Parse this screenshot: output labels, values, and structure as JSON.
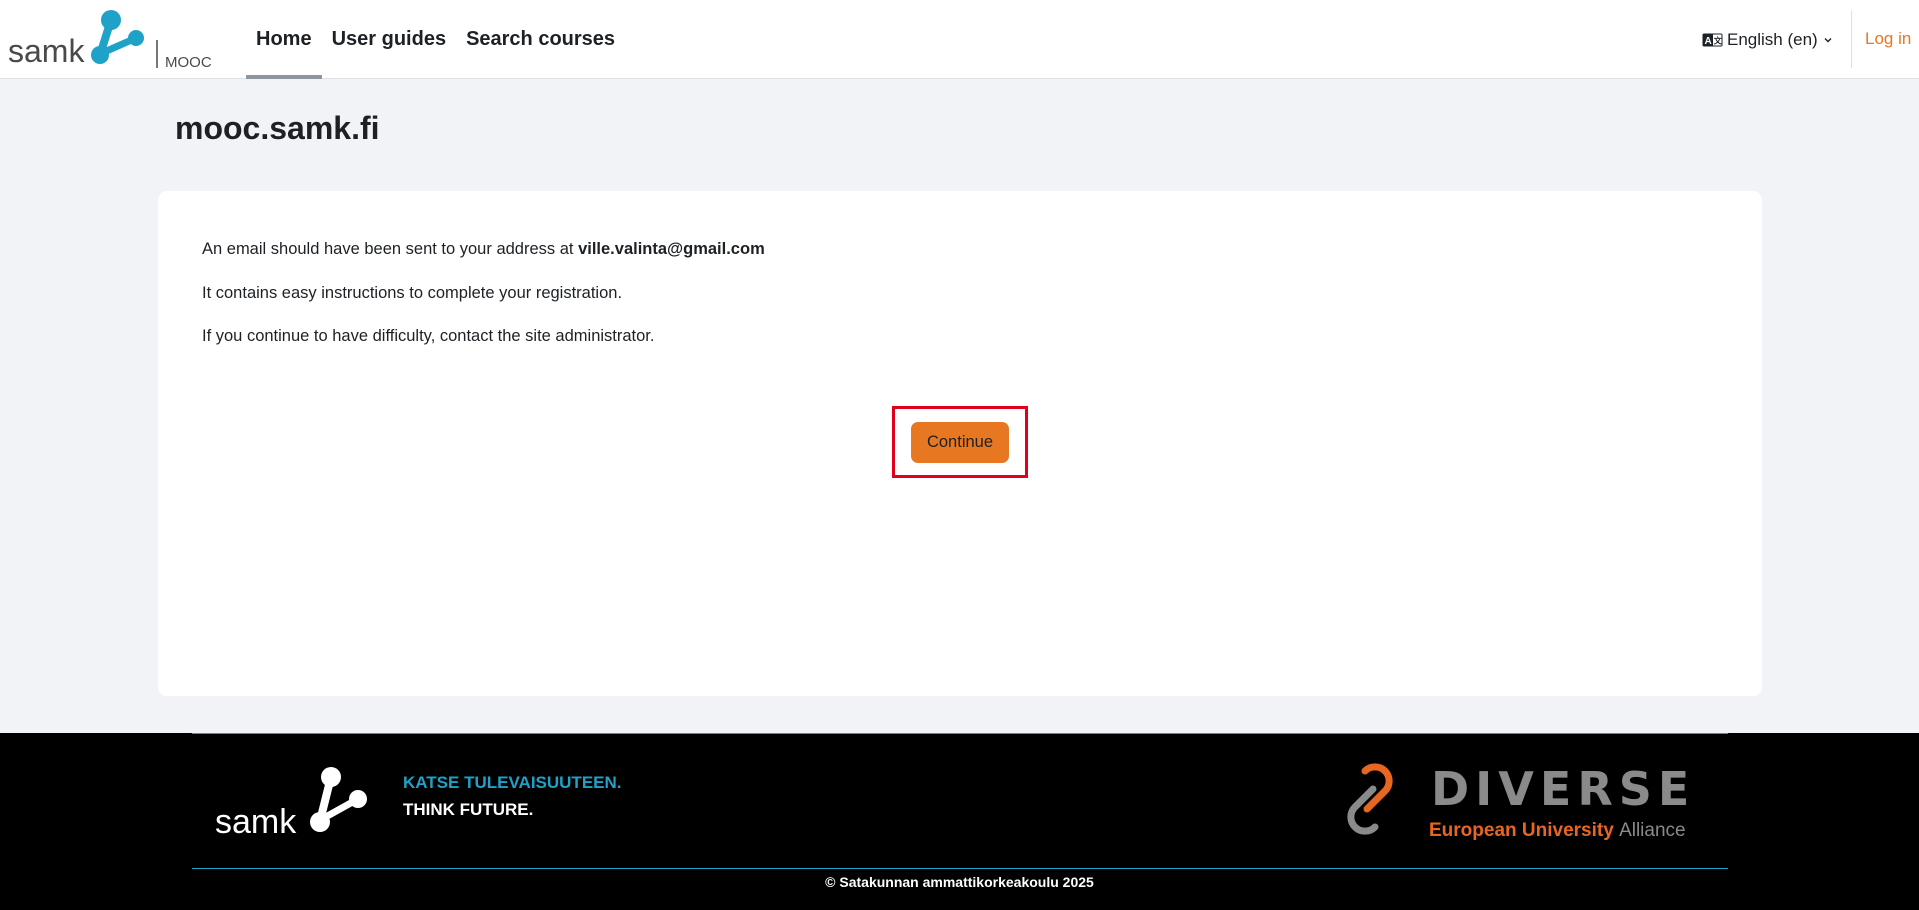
{
  "navbar": {
    "brand_text": "samk",
    "brand_sub": "MOOC",
    "links": [
      {
        "label": "Home",
        "active": true
      },
      {
        "label": "User guides",
        "active": false
      },
      {
        "label": "Search courses",
        "active": false
      }
    ],
    "language": "English (en)",
    "language_icon": "language-icon",
    "login": "Log in"
  },
  "page": {
    "title": "mooc.samk.fi"
  },
  "message": {
    "line1_prefix": "An email should have been sent to your address at ",
    "email": "ville.valinta@gmail.com",
    "line2": "It contains easy instructions to complete your registration.",
    "line3": "If you continue to have difficulty, contact the site administrator.",
    "continue_label": "Continue"
  },
  "footer": {
    "brand_text": "samk",
    "slogan_fi": "KATSE TULEVAISUUTEEN.",
    "slogan_en": "THINK FUTURE.",
    "partner_name": "DIVERSE",
    "partner_tag_1": "European University",
    "partner_tag_2": "Alliance",
    "copyright": "© Satakunnan ammattikorkeakoulu 2025"
  },
  "colors": {
    "accent": "#e87722",
    "samk_blue": "#1ea2c8",
    "highlight": "#e0001b",
    "background": "#f2f3f7"
  }
}
